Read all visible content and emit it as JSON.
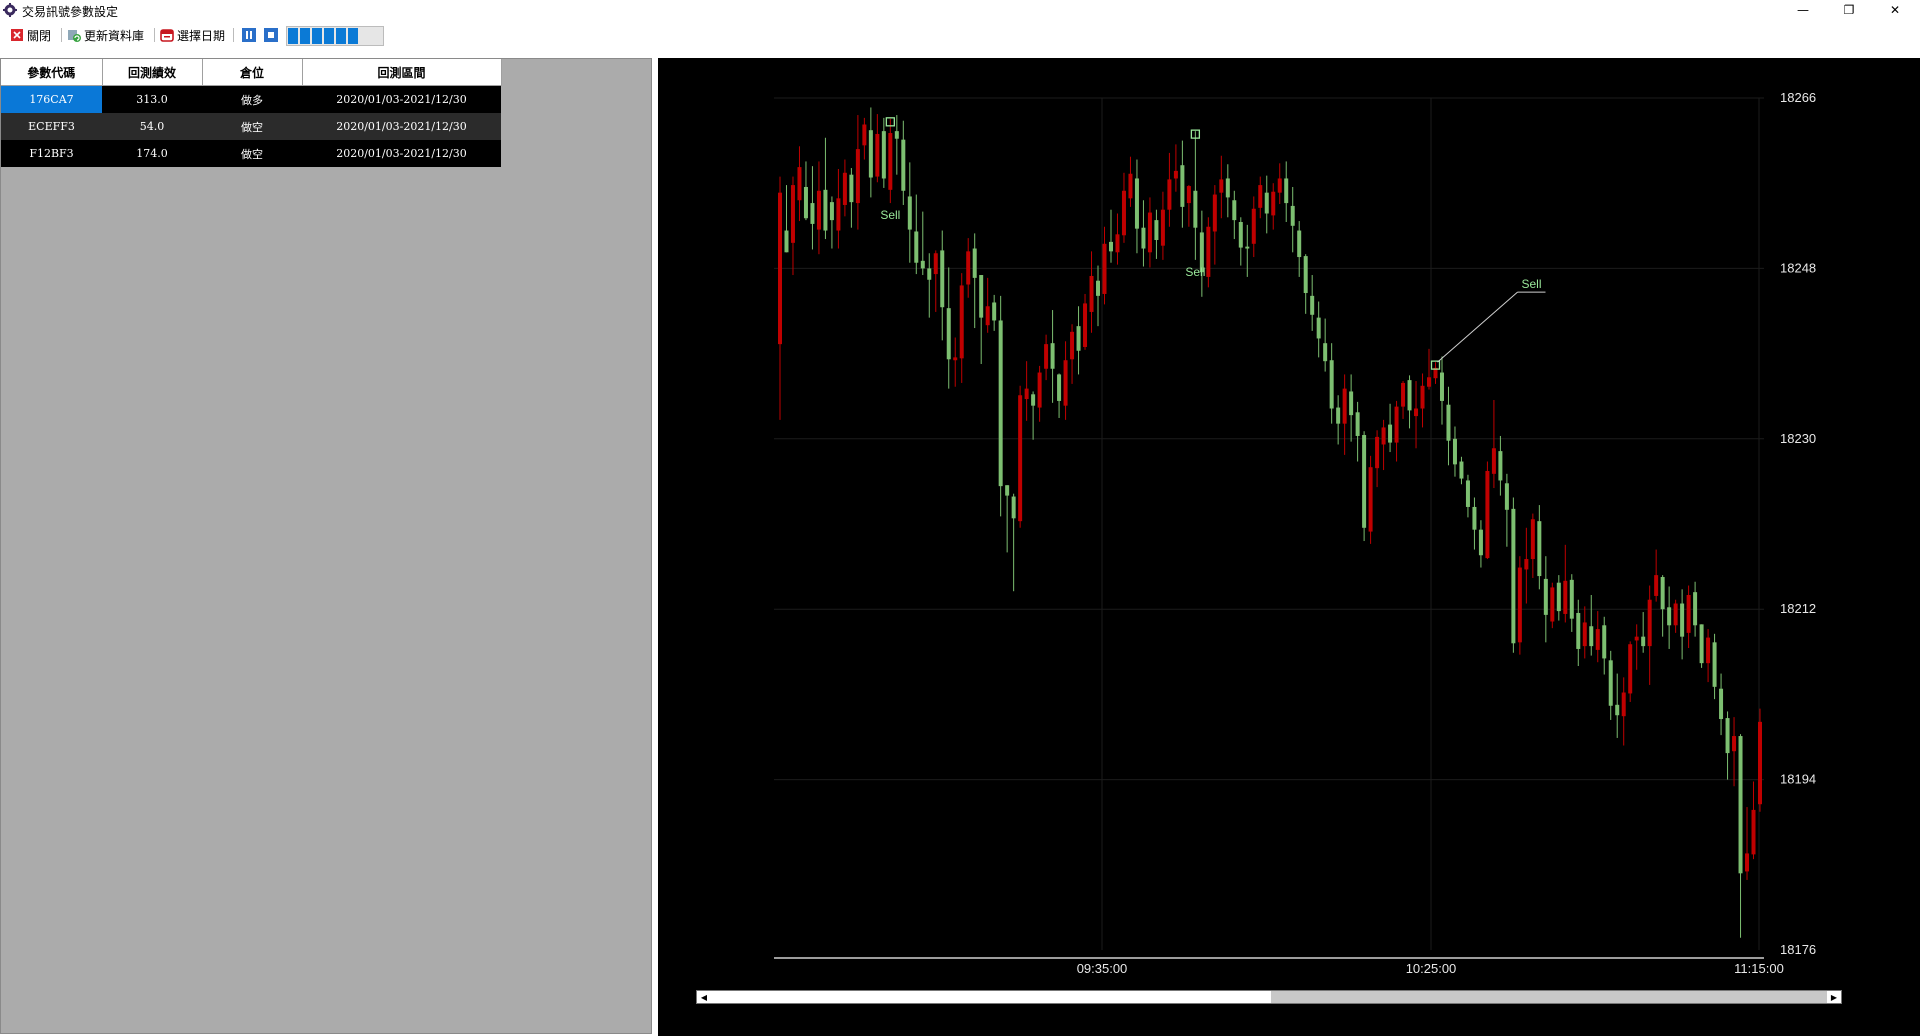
{
  "window": {
    "title": "交易訊號參數設定",
    "min_glyph": "—",
    "max_glyph": "❐",
    "close_glyph": "✕"
  },
  "toolbar": {
    "close_label": "關閉",
    "update_label": "更新資料庫",
    "date_label": "選擇日期",
    "progress_segments": 6
  },
  "grid": {
    "columns": [
      "參數代碼",
      "回測績效",
      "倉位",
      "回測區間"
    ],
    "rows": [
      [
        "176CA7",
        "313.0",
        "做多",
        "2020/01/03-2021/12/30"
      ],
      [
        "ECEFF3",
        "54.0",
        "做空",
        "2020/01/03-2021/12/30"
      ],
      [
        "F12BF3",
        "174.0",
        "做空",
        "2020/01/03-2021/12/30"
      ]
    ]
  },
  "chart_data": {
    "type": "candlestick",
    "y_ticks": [
      18266,
      18248,
      18230,
      18212,
      18194,
      18176
    ],
    "ylim": [
      18176,
      18266
    ],
    "x_ticks": [
      "09:35:00",
      "10:25:00",
      "11:15:00"
    ],
    "grid": true,
    "colors": {
      "up": "#c00000",
      "down": "#7dbf71",
      "marker": "#9ae89a",
      "grid": "#1c1c1c",
      "axis": "#cfcfcf"
    },
    "markers": [
      {
        "label": "Sell",
        "bar": 17
      },
      {
        "label": "Sell",
        "bar": 64
      },
      {
        "label": "Sell",
        "bar": 101
      }
    ],
    "candles": [
      [
        18240.0,
        18256.0,
        18232.0,
        18257.7
      ],
      [
        18252.0,
        18249.7,
        18249.7,
        18256.8
      ],
      [
        18250.7,
        18256.8,
        18247.3,
        18257.7
      ],
      [
        18255.2,
        18258.7,
        18253.0,
        18260.9
      ],
      [
        18256.6,
        18253.3,
        18253.1,
        18259.3
      ],
      [
        18254.9,
        18252.7,
        18250.0,
        18258.8
      ],
      [
        18252.1,
        18256.2,
        18249.5,
        18259.3
      ],
      [
        18256.3,
        18252.0,
        18251.1,
        18261.8
      ],
      [
        18255.0,
        18253.1,
        18250.1,
        18255.6
      ],
      [
        18252.0,
        18255.4,
        18250.1,
        18258.5
      ],
      [
        18254.7,
        18258.1,
        18253.5,
        18259.5
      ],
      [
        18257.9,
        18255.0,
        18252.3,
        18258.6
      ],
      [
        18254.9,
        18260.6,
        18252.1,
        18264.2
      ],
      [
        18261.0,
        18263.2,
        18259.5,
        18263.9
      ],
      [
        18262.6,
        18257.6,
        18255.5,
        18265.0
      ],
      [
        18257.7,
        18262.2,
        18257.1,
        18264.3
      ],
      [
        18262.5,
        18257.5,
        18256.5,
        18263.9
      ],
      [
        18256.3,
        18262.3,
        18254.9,
        18263.8
      ],
      [
        18262.5,
        18261.7,
        18257.9,
        18264.2
      ],
      [
        18261.6,
        18256.2,
        18254.7,
        18263.6
      ],
      [
        18255.6,
        18252.1,
        18248.6,
        18259.2
      ],
      [
        18251.9,
        18248.6,
        18247.4,
        18255.8
      ],
      [
        18248.8,
        18248.0,
        18247.3,
        18254.0
      ],
      [
        18248.0,
        18246.8,
        18242.8,
        18249.6
      ],
      [
        18247.4,
        18249.6,
        18243.4,
        18249.9
      ],
      [
        18249.9,
        18243.9,
        18240.4,
        18252.0
      ],
      [
        18243.8,
        18238.4,
        18235.3,
        18248.1
      ],
      [
        18238.3,
        18238.6,
        18235.5,
        18240.7
      ],
      [
        18238.5,
        18246.2,
        18235.9,
        18247.5
      ],
      [
        18246.3,
        18249.8,
        18244.9,
        18251.2
      ],
      [
        18250.1,
        18247.0,
        18241.7,
        18251.7
      ],
      [
        18247.3,
        18242.8,
        18237.9,
        18247.3
      ],
      [
        18242.0,
        18244.0,
        18241.2,
        18247.0
      ],
      [
        18244.4,
        18242.5,
        18241.4,
        18245.2
      ],
      [
        18242.5,
        18225.0,
        18221.8,
        18245.1
      ],
      [
        18225.1,
        18224.0,
        18218.0,
        18225.1
      ],
      [
        18223.9,
        18221.6,
        18213.9,
        18224.2
      ],
      [
        18221.3,
        18234.6,
        18220.6,
        18235.6
      ],
      [
        18234.2,
        18235.3,
        18231.9,
        18238.2
      ],
      [
        18234.7,
        18233.5,
        18229.9,
        18235.0
      ],
      [
        18233.3,
        18237.0,
        18231.8,
        18237.7
      ],
      [
        18237.4,
        18240.0,
        18236.2,
        18241.0
      ],
      [
        18240.1,
        18237.4,
        18233.8,
        18243.6
      ],
      [
        18236.8,
        18234.0,
        18232.2,
        18236.9
      ],
      [
        18233.5,
        18238.3,
        18232.0,
        18240.3
      ],
      [
        18238.4,
        18241.3,
        18235.8,
        18242.1
      ],
      [
        18241.9,
        18239.3,
        18236.8,
        18244.0
      ],
      [
        18239.7,
        18244.3,
        18239.4,
        18245.3
      ],
      [
        18243.4,
        18247.2,
        18241.2,
        18249.8
      ],
      [
        18246.7,
        18245.1,
        18241.9,
        18248.3
      ],
      [
        18245.3,
        18250.6,
        18244.2,
        18252.4
      ],
      [
        18250.8,
        18249.8,
        18248.6,
        18254.2
      ],
      [
        18249.7,
        18251.6,
        18248.4,
        18253.8
      ],
      [
        18251.5,
        18256.2,
        18250.7,
        18258.1
      ],
      [
        18255.4,
        18258.0,
        18254.5,
        18259.8
      ],
      [
        18257.5,
        18252.2,
        18249.6,
        18259.5
      ],
      [
        18252.3,
        18250.1,
        18248.2,
        18255.2
      ],
      [
        18249.7,
        18253.9,
        18248.1,
        18255.5
      ],
      [
        18253.1,
        18251.0,
        18249.0,
        18254.2
      ],
      [
        18250.4,
        18254.2,
        18248.9,
        18256.1
      ],
      [
        18254.2,
        18257.4,
        18252.4,
        18260.2
      ],
      [
        18257.5,
        18258.3,
        18256.1,
        18261.1
      ],
      [
        18258.9,
        18254.5,
        18252.3,
        18261.5
      ],
      [
        18254.9,
        18256.7,
        18252.4,
        18256.8
      ],
      [
        18256.2,
        18252.3,
        18248.9,
        18262.5
      ],
      [
        18251.8,
        18247.6,
        18245.0,
        18254.1
      ],
      [
        18247.1,
        18252.4,
        18246.0,
        18253.4
      ],
      [
        18251.9,
        18255.8,
        18248.4,
        18256.8
      ],
      [
        18256.0,
        18257.4,
        18253.3,
        18259.9
      ],
      [
        18257.5,
        18255.5,
        18253.4,
        18259.0
      ],
      [
        18255.2,
        18253.1,
        18251.1,
        18256.2
      ],
      [
        18252.9,
        18250.2,
        18248.3,
        18253.4
      ],
      [
        18250.3,
        18250.1,
        18247.1,
        18252.6
      ],
      [
        18250.6,
        18254.3,
        18249.2,
        18255.6
      ],
      [
        18254.4,
        18256.8,
        18253.3,
        18257.7
      ],
      [
        18256.0,
        18253.8,
        18251.7,
        18257.8
      ],
      [
        18253.6,
        18256.1,
        18252.1,
        18257.0
      ],
      [
        18256.0,
        18257.5,
        18254.8,
        18259.1
      ],
      [
        18257.5,
        18254.9,
        18252.9,
        18259.3
      ],
      [
        18254.6,
        18252.5,
        18249.7,
        18256.6
      ],
      [
        18252.0,
        18249.2,
        18247.1,
        18253.0
      ],
      [
        18249.3,
        18245.4,
        18243.2,
        18249.5
      ],
      [
        18245.1,
        18243.1,
        18241.4,
        18247.3
      ],
      [
        18242.8,
        18240.6,
        18238.6,
        18244.5
      ],
      [
        18240.1,
        18238.2,
        18237.1,
        18242.7
      ],
      [
        18238.3,
        18233.2,
        18231.6,
        18240.1
      ],
      [
        18233.3,
        18231.6,
        18229.4,
        18234.6
      ],
      [
        18231.6,
        18235.3,
        18228.3,
        18236.8
      ],
      [
        18235.0,
        18232.5,
        18229.7,
        18236.8
      ],
      [
        18232.8,
        18230.3,
        18227.6,
        18233.9
      ],
      [
        18230.4,
        18220.6,
        18219.2,
        18230.8
      ],
      [
        18220.2,
        18227.0,
        18218.9,
        18228.2
      ],
      [
        18226.9,
        18230.2,
        18224.9,
        18230.9
      ],
      [
        18229.4,
        18231.2,
        18226.7,
        18232.0
      ],
      [
        18231.5,
        18229.6,
        18228.6,
        18233.7
      ],
      [
        18229.6,
        18233.4,
        18227.6,
        18234.0
      ],
      [
        18233.4,
        18235.9,
        18232.1,
        18236.1
      ],
      [
        18236.2,
        18233.0,
        18231.1,
        18236.7
      ],
      [
        18232.4,
        18233.2,
        18229.0,
        18236.1
      ],
      [
        18233.2,
        18235.6,
        18231.2,
        18236.9
      ],
      [
        18235.5,
        18236.5,
        18235.2,
        18239.5
      ],
      [
        18236.4,
        18237.5,
        18235.8,
        18238.1
      ],
      [
        18237.0,
        18234.0,
        18231.5,
        18238.7
      ],
      [
        18233.6,
        18229.8,
        18227.2,
        18235.5
      ],
      [
        18230.0,
        18227.3,
        18226.0,
        18231.3
      ],
      [
        18227.6,
        18225.8,
        18225.2,
        18228.1
      ],
      [
        18225.6,
        18222.8,
        18221.7,
        18226.2
      ],
      [
        18222.8,
        18220.4,
        18218.3,
        18223.8
      ],
      [
        18220.4,
        18217.7,
        18216.4,
        18221.4
      ],
      [
        18217.4,
        18226.6,
        18217.3,
        18227.6
      ],
      [
        18226.3,
        18229.0,
        18224.8,
        18234.1
      ],
      [
        18228.7,
        18225.6,
        18224.0,
        18230.3
      ],
      [
        18225.3,
        18222.5,
        18218.6,
        18226.3
      ],
      [
        18222.6,
        18208.4,
        18207.4,
        18223.8
      ],
      [
        18208.5,
        18216.4,
        18207.2,
        18217.6
      ],
      [
        18216.2,
        18217.3,
        18212.6,
        18220.6
      ],
      [
        18217.3,
        18221.5,
        18215.3,
        18222.1
      ],
      [
        18221.3,
        18215.5,
        18214.1,
        18223.0
      ],
      [
        18215.2,
        18211.4,
        18208.5,
        18217.6
      ],
      [
        18210.7,
        18214.3,
        18210.0,
        18214.8
      ],
      [
        18214.8,
        18211.8,
        18210.8,
        18215.6
      ],
      [
        18211.5,
        18215.0,
        18210.6,
        18218.8
      ],
      [
        18215.1,
        18211.0,
        18209.6,
        18215.7
      ],
      [
        18211.6,
        18207.8,
        18206.0,
        18213.0
      ],
      [
        18208.1,
        18210.6,
        18206.8,
        18212.3
      ],
      [
        18210.2,
        18208.1,
        18207.1,
        18213.5
      ],
      [
        18207.7,
        18209.9,
        18206.4,
        18211.8
      ],
      [
        18210.3,
        18206.8,
        18205.1,
        18211.2
      ],
      [
        18206.6,
        18201.8,
        18200.3,
        18207.6
      ],
      [
        18201.9,
        18200.8,
        18198.4,
        18205.2
      ],
      [
        18200.7,
        18203.2,
        18197.6,
        18204.8
      ],
      [
        18203.1,
        18208.3,
        18202.2,
        18208.6
      ],
      [
        18208.7,
        18209.1,
        18205.6,
        18210.4
      ],
      [
        18209.1,
        18208.1,
        18207.4,
        18211.7
      ],
      [
        18208.1,
        18213.0,
        18204.0,
        18214.5
      ],
      [
        18213.4,
        18215.6,
        18212.8,
        18218.3
      ],
      [
        18215.4,
        18212.0,
        18209.1,
        18215.6
      ],
      [
        18212.2,
        18210.3,
        18207.8,
        18214.4
      ],
      [
        18210.3,
        18212.6,
        18209.5,
        18213.0
      ],
      [
        18212.6,
        18209.1,
        18206.7,
        18214.1
      ],
      [
        18209.5,
        18213.5,
        18207.9,
        18214.5
      ],
      [
        18213.8,
        18210.3,
        18209.1,
        18214.9
      ],
      [
        18210.4,
        18206.3,
        18205.8,
        18210.4
      ],
      [
        18206.3,
        18209.0,
        18204.3,
        18209.9
      ],
      [
        18208.5,
        18203.8,
        18202.5,
        18209.4
      ],
      [
        18203.6,
        18200.4,
        18198.7,
        18205.2
      ],
      [
        18200.5,
        18196.8,
        18194.0,
        18201.2
      ],
      [
        18197.0,
        18198.6,
        18193.3,
        18200.6
      ],
      [
        18198.6,
        18184.1,
        18177.3,
        18198.8
      ],
      [
        18184.3,
        18186.2,
        18183.4,
        18191.1
      ],
      [
        18186.1,
        18190.8,
        18185.6,
        18193.8
      ],
      [
        18191.4,
        18200.1,
        18190.6,
        18201.5
      ]
    ]
  }
}
